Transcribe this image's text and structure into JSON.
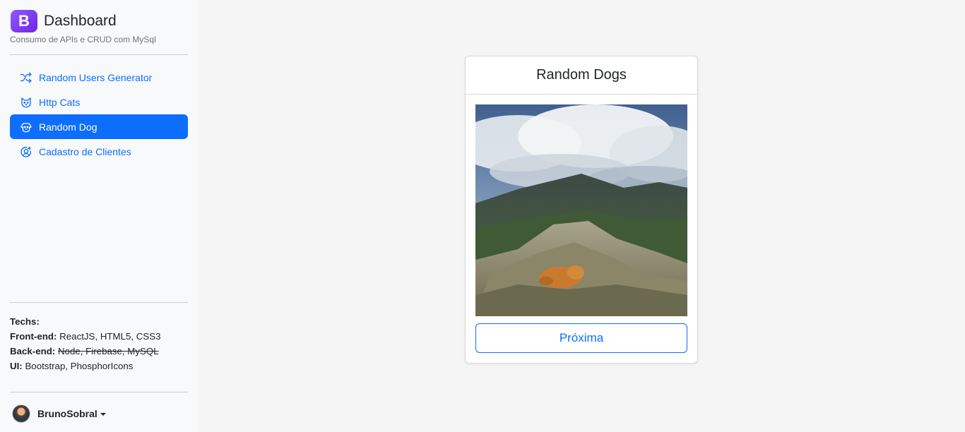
{
  "brand": {
    "logo_letter": "B",
    "title": "Dashboard",
    "subtitle": "Consumo de APIs e CRUD com MySql"
  },
  "nav": [
    {
      "label": "Random Users Generator",
      "icon": "shuffle-icon",
      "active": false
    },
    {
      "label": "Http Cats",
      "icon": "cat-icon",
      "active": false
    },
    {
      "label": "Random Dog",
      "icon": "dog-icon",
      "active": true
    },
    {
      "label": "Cadastro de Clientes",
      "icon": "user-circle-plus-icon",
      "active": false
    }
  ],
  "techs": {
    "heading": "Techs:",
    "frontend_label": "Front-end:",
    "frontend_value": "ReactJS, HTML5, CSS3",
    "backend_label": "Back-end:",
    "backend_value": "Node, Firebase, MySQL",
    "ui_label": "UI:",
    "ui_value": "Bootstrap, PhosphorIcons"
  },
  "user": {
    "name": "BrunoSobral"
  },
  "card": {
    "title": "Random Dogs",
    "image_alt": "dog sleeping on mountain rocks",
    "next_button": "Próxima"
  },
  "colors": {
    "primary": "#0d6efd",
    "brand_purple": "#7a3cf0",
    "page_bg": "#f5f5f5",
    "sidebar_bg": "#f8f9fa"
  }
}
